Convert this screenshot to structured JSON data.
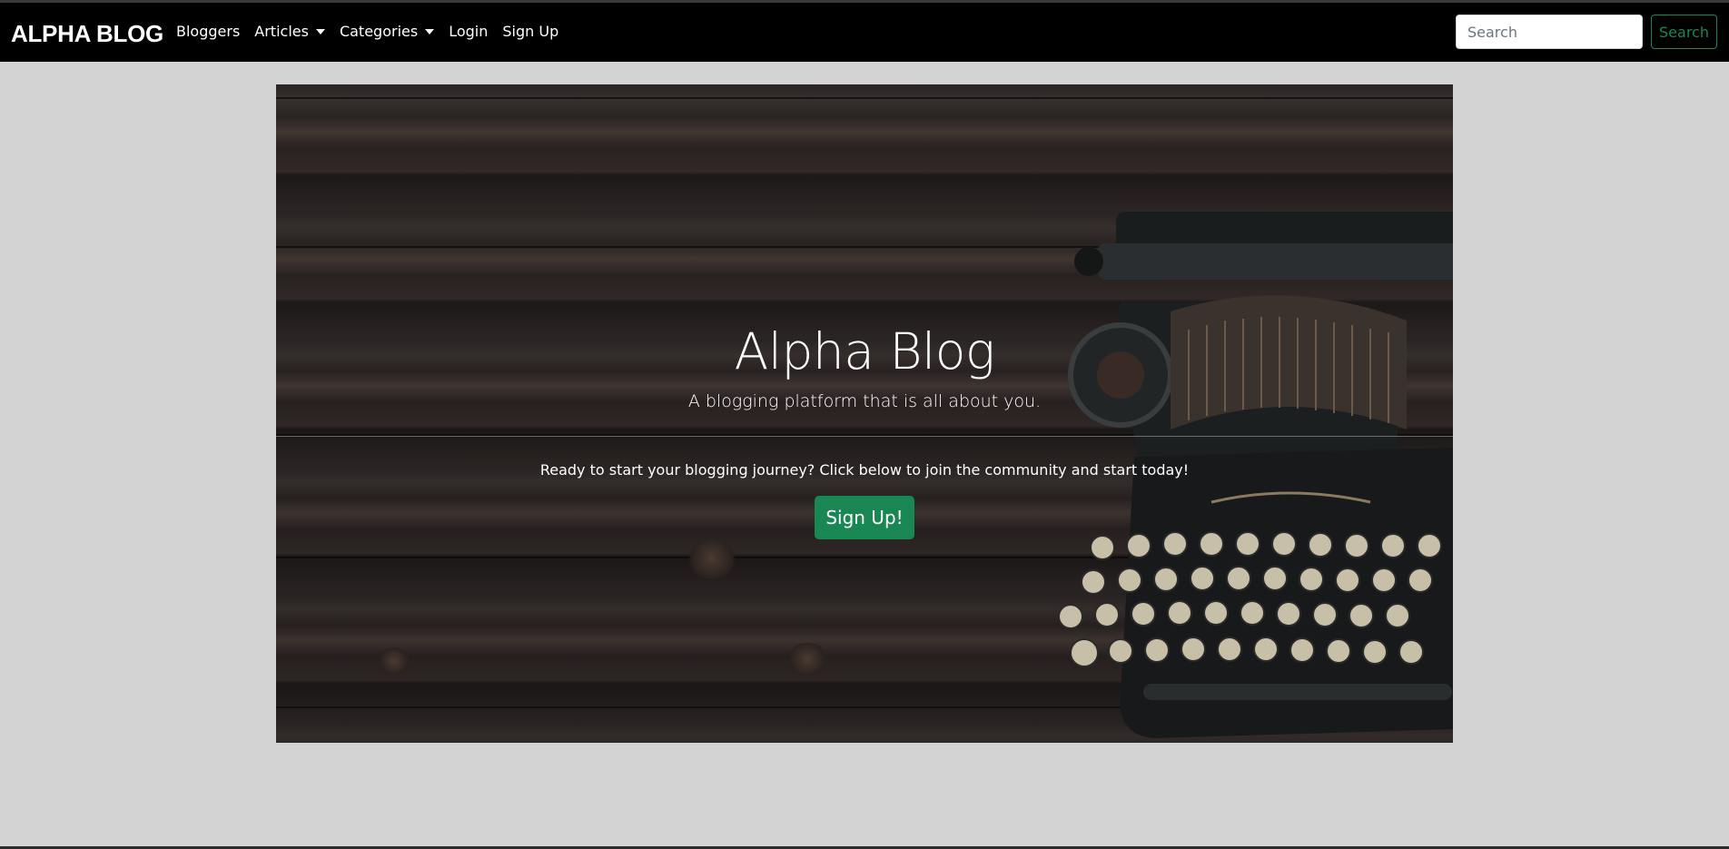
{
  "navbar": {
    "brand": "ALPHA BLOG",
    "links": [
      {
        "label": "Bloggers"
      },
      {
        "label": "Articles"
      },
      {
        "label": "Categories"
      },
      {
        "label": "Login"
      },
      {
        "label": "Sign Up"
      }
    ],
    "search": {
      "placeholder": "Search",
      "value": "",
      "button_label": "Search"
    }
  },
  "hero": {
    "title": "Alpha Blog",
    "subtitle": "A blogging platform that is all about you.",
    "text": "Ready to start your blogging journey? Click below to join the community and start today!",
    "button_label": "Sign Up!"
  },
  "colors": {
    "navbar_bg": "#000000",
    "page_bg": "#d3d3d3",
    "accent_green": "#198754"
  }
}
